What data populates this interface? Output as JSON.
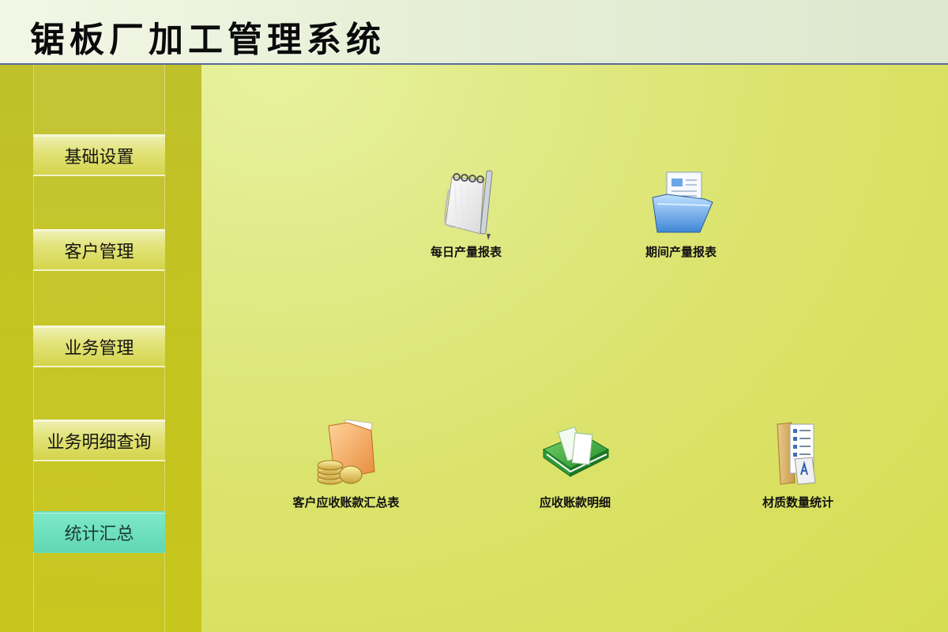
{
  "header": {
    "title": "锯板厂加工管理系统"
  },
  "sidebar": {
    "items": [
      {
        "label": "基础设置",
        "active": false
      },
      {
        "label": "客户管理",
        "active": false
      },
      {
        "label": "业务管理",
        "active": false
      },
      {
        "label": "业务明细查询",
        "active": false
      },
      {
        "label": "统计汇总",
        "active": true
      }
    ]
  },
  "main": {
    "tiles": [
      {
        "label": "每日产量报表",
        "icon": "notepad-pen-icon"
      },
      {
        "label": "期间产量报表",
        "icon": "folder-document-icon"
      },
      {
        "label": "客户应收账款汇总表",
        "icon": "folder-coins-icon"
      },
      {
        "label": "应收账款明细",
        "icon": "green-book-icon"
      },
      {
        "label": "材质数量统计",
        "icon": "folder-checklist-icon"
      }
    ]
  },
  "colors": {
    "sidebar": "#c2c224",
    "nav_button": "#e2e37a",
    "nav_active": "#6fe1bd",
    "header_border": "#5c6a9a"
  }
}
